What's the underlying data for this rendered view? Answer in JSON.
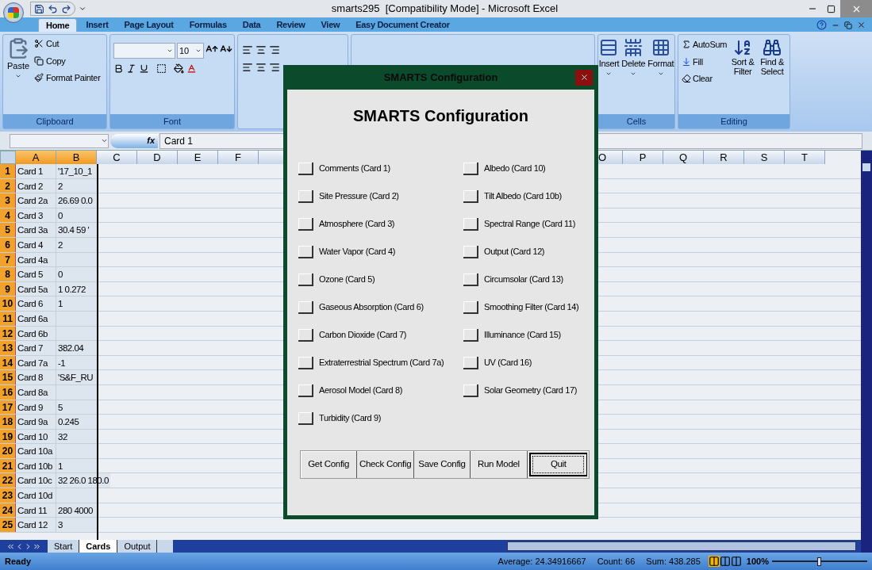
{
  "window": {
    "title": "smarts295  [Compatibility Mode] - Microsoft Excel"
  },
  "ribbon_tabs": [
    {
      "label": "Home",
      "selected": true
    },
    {
      "label": "Insert",
      "selected": false
    },
    {
      "label": "Page Layout",
      "selected": false
    },
    {
      "label": "Formulas",
      "selected": false
    },
    {
      "label": "Data",
      "selected": false
    },
    {
      "label": "Review",
      "selected": false
    },
    {
      "label": "View",
      "selected": false
    },
    {
      "label": "Easy Document Creator",
      "selected": false
    }
  ],
  "clipboard": {
    "paste": "Paste",
    "cut": "Cut",
    "copy": "Copy",
    "format_painter": "Format Painter",
    "group": "Clipboard"
  },
  "font": {
    "font_size": "10",
    "group": "Font"
  },
  "cells": {
    "insert": "Insert",
    "delete": "Delete",
    "format": "Format",
    "group": "Cells"
  },
  "editing": {
    "autosum": "AutoSum",
    "fill": "Fill",
    "clear": "Clear",
    "sort_filter": "Sort & Filter",
    "find_select": "Find & Select",
    "group": "Editing"
  },
  "formula_bar": {
    "function_label": "fx",
    "value": "Card 1"
  },
  "columns_left": [
    {
      "label": "A",
      "selected": true
    },
    {
      "label": "B",
      "selected": true
    },
    {
      "label": "C",
      "selected": false
    },
    {
      "label": "D",
      "selected": false
    },
    {
      "label": "E",
      "selected": false
    },
    {
      "label": "F",
      "selected": false
    }
  ],
  "columns_right": [
    "O",
    "P",
    "Q",
    "R",
    "S",
    "T"
  ],
  "rows": [
    {
      "num": "1",
      "a": "Card 1",
      "b": "'17_10_1"
    },
    {
      "num": "2",
      "a": "Card 2",
      "b": "2"
    },
    {
      "num": "3",
      "a": "Card 2a",
      "b": "26.69 0.0"
    },
    {
      "num": "4",
      "a": "Card 3",
      "b": "0"
    },
    {
      "num": "5",
      "a": "Card 3a",
      "b": "30.4 59 '"
    },
    {
      "num": "6",
      "a": "Card 4",
      "b": "2"
    },
    {
      "num": "7",
      "a": "Card 4a",
      "b": ""
    },
    {
      "num": "8",
      "a": "Card 5",
      "b": "0"
    },
    {
      "num": "9",
      "a": "Card 5a",
      "b": "1 0.272"
    },
    {
      "num": "10",
      "a": "Card 6",
      "b": "1"
    },
    {
      "num": "11",
      "a": "Card 6a",
      "b": ""
    },
    {
      "num": "12",
      "a": "Card 6b",
      "b": ""
    },
    {
      "num": "13",
      "a": "Card 7",
      "b": "382.04"
    },
    {
      "num": "14",
      "a": "Card 7a",
      "b": "-1"
    },
    {
      "num": "15",
      "a": "Card 8",
      "b": "'S&F_RU"
    },
    {
      "num": "16",
      "a": "Card 8a",
      "b": ""
    },
    {
      "num": "17",
      "a": "Card 9",
      "b": "5"
    },
    {
      "num": "18",
      "a": "Card 9a",
      "b": "0.245"
    },
    {
      "num": "19",
      "a": "Card 10",
      "b": "32"
    },
    {
      "num": "20",
      "a": "Card 10a",
      "b": ""
    },
    {
      "num": "21",
      "a": "Card 10b",
      "b": "1"
    },
    {
      "num": "22",
      "a": "Card 10c",
      "b": "32 26.0 180.0"
    },
    {
      "num": "23",
      "a": "Card 10d",
      "b": ""
    },
    {
      "num": "24",
      "a": "Card 11",
      "b": "280 4000"
    },
    {
      "num": "25",
      "a": "Card 12",
      "b": "3"
    }
  ],
  "sheet_tabs": [
    {
      "label": "Start",
      "selected": false
    },
    {
      "label": "Cards",
      "selected": true
    },
    {
      "label": "Output",
      "selected": false
    }
  ],
  "status_bar": {
    "mode": "Ready",
    "average": "Average: 24.34916667",
    "count": "Count: 66",
    "sum": "Sum: 438.285",
    "zoom": "100%",
    "zoom_slider": {
      "level": 0.5
    }
  },
  "dialog": {
    "title": "SMARTS Configuration",
    "heading": "SMARTS Configuration",
    "left_options": [
      {
        "label": "Comments (Card 1)",
        "checked": false
      },
      {
        "label": "Site Pressure (Card 2)",
        "checked": false
      },
      {
        "label": "Atmosphere (Card 3)",
        "checked": false
      },
      {
        "label": "Water Vapor (Card 4)",
        "checked": false
      },
      {
        "label": "Ozone (Card 5)",
        "checked": false
      },
      {
        "label": "Gaseous Absorption (Card 6)",
        "checked": false
      },
      {
        "label": "Carbon Dioxide (Card 7)",
        "checked": false
      },
      {
        "label": "Extraterrestrial Spectrum (Card 7a)",
        "checked": false
      },
      {
        "label": "Aerosol Model (Card 8)",
        "checked": false
      },
      {
        "label": "Turbidity (Card 9)",
        "checked": false
      }
    ],
    "right_options": [
      {
        "label": "Albedo (Card 10)",
        "checked": false
      },
      {
        "label": "Tilt Albedo (Card 10b)",
        "checked": false
      },
      {
        "label": "Spectral Range (Card 11)",
        "checked": false
      },
      {
        "label": "Output (Card 12)",
        "checked": false
      },
      {
        "label": "Circumsolar (Card 13)",
        "checked": false
      },
      {
        "label": "Smoothing Filter (Card 14)",
        "checked": false
      },
      {
        "label": "Illuminance (Card 15)",
        "checked": false
      },
      {
        "label": "UV (Card 16)",
        "checked": false
      },
      {
        "label": "Solar Geometry (Card 17)",
        "checked": false
      }
    ],
    "buttons": [
      {
        "label": "Get Config",
        "default": false
      },
      {
        "label": "Check Config",
        "default": false
      },
      {
        "label": "Save Config",
        "default": false
      },
      {
        "label": "Run Model",
        "default": false
      },
      {
        "label": "Quit",
        "default": true
      }
    ]
  }
}
